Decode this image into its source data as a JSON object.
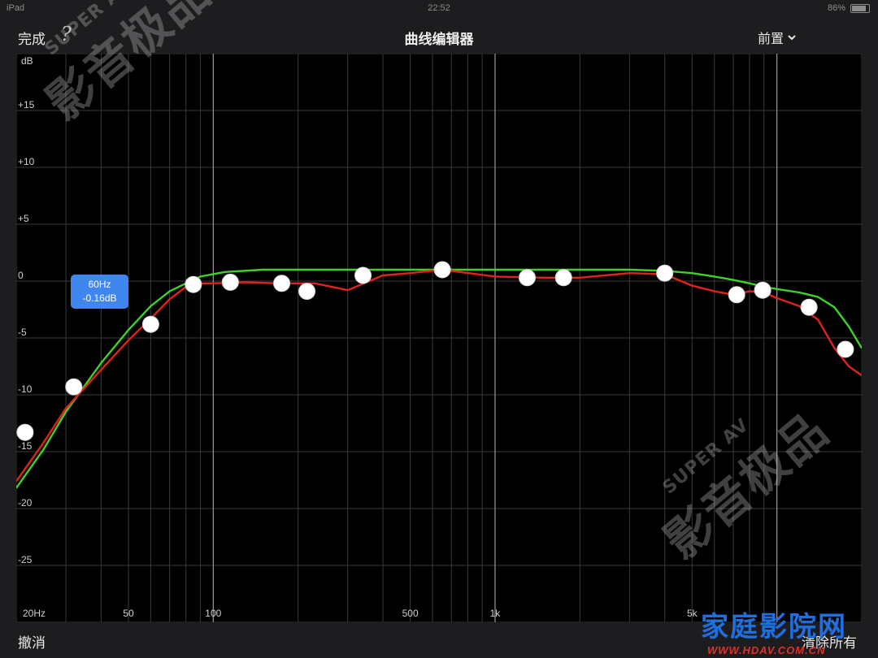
{
  "status_bar": {
    "device": "iPad",
    "time": "22:52",
    "battery": "86%",
    "battery_level": 0.86
  },
  "nav": {
    "done_label": "完成",
    "help_label": "?",
    "title": "曲线编辑器",
    "presets_label": "前置"
  },
  "toolbar": {
    "undo_label": "撤消",
    "clear_all_label": "清除所有"
  },
  "tooltip": {
    "freq": "60Hz",
    "gain": "-0.16dB"
  },
  "watermark": {
    "text": "影音极品",
    "sub": "SUPER AV"
  },
  "site_logo": {
    "name": "家庭影院网",
    "url": "WWW.HDAV.COM.CN"
  },
  "colors": {
    "target_curve": "#3fd129",
    "measured_curve": "#e0221c",
    "grid": "#3a3a3a",
    "grid_major": "#9a9a9a",
    "tooltip": "#3f86ee"
  },
  "chart_data": {
    "type": "line",
    "xscale": "log",
    "xlim": [
      20,
      20000
    ],
    "ylim": [
      -30,
      20
    ],
    "yunit_label": "dB",
    "ytick_labels": [
      {
        "value": 15,
        "label": "+15"
      },
      {
        "value": 10,
        "label": "+10"
      },
      {
        "value": 5,
        "label": "+5"
      },
      {
        "value": 0,
        "label": "0"
      },
      {
        "value": -5,
        "label": "-5"
      },
      {
        "value": -10,
        "label": "-10"
      },
      {
        "value": -15,
        "label": "-15"
      },
      {
        "value": -20,
        "label": "-20"
      },
      {
        "value": -25,
        "label": "-25"
      }
    ],
    "xtick_labels": [
      {
        "value": 20,
        "label": "20Hz"
      },
      {
        "value": 50,
        "label": "50"
      },
      {
        "value": 100,
        "label": "100"
      },
      {
        "value": 500,
        "label": "500"
      },
      {
        "value": 1000,
        "label": "1k"
      },
      {
        "value": 5000,
        "label": "5k"
      }
    ],
    "series": [
      {
        "id": "target",
        "x": [
          20,
          25,
          30,
          40,
          50,
          60,
          70,
          80,
          90,
          110,
          150,
          200,
          300,
          500,
          700,
          1000,
          1500,
          2000,
          3000,
          4000,
          5000,
          6000,
          7000,
          8000,
          9000,
          10000,
          12000,
          14000,
          16000,
          18000,
          20000
        ],
        "y": [
          -18.2,
          -14.8,
          -11.5,
          -7.2,
          -4.3,
          -2.2,
          -0.9,
          -0.2,
          0.4,
          0.8,
          1.0,
          1.0,
          1.0,
          1.0,
          1.0,
          1.0,
          1.0,
          1.0,
          1.0,
          0.9,
          0.7,
          0.4,
          0.1,
          -0.2,
          -0.5,
          -0.7,
          -1.0,
          -1.4,
          -2.3,
          -4.0,
          -5.9
        ]
      },
      {
        "id": "measured",
        "x": [
          20,
          25,
          30,
          40,
          50,
          60,
          70,
          80,
          90,
          100,
          130,
          170,
          230,
          300,
          400,
          500,
          650,
          1000,
          1500,
          2000,
          3000,
          4000,
          5000,
          6000,
          7000,
          8000,
          9000,
          10000,
          12000,
          14000,
          16000,
          18000,
          20000
        ],
        "y": [
          -17.6,
          -14.2,
          -11.2,
          -7.8,
          -5.2,
          -3.3,
          -1.6,
          -0.5,
          -0.2,
          -0.2,
          -0.1,
          -0.2,
          -0.2,
          -0.8,
          0.5,
          0.7,
          1.0,
          0.4,
          0.3,
          0.3,
          0.7,
          0.6,
          -0.4,
          -0.9,
          -1.2,
          -0.9,
          -1.0,
          -1.5,
          -2.2,
          -3.4,
          -5.9,
          -7.5,
          -8.3
        ]
      }
    ],
    "control_points": [
      {
        "x": 21.5,
        "y": -13.3
      },
      {
        "x": 32,
        "y": -9.3
      },
      {
        "x": 60,
        "y": -3.8
      },
      {
        "x": 85,
        "y": -0.3
      },
      {
        "x": 115,
        "y": -0.1
      },
      {
        "x": 175,
        "y": -0.2
      },
      {
        "x": 215,
        "y": -0.9
      },
      {
        "x": 340,
        "y": 0.5
      },
      {
        "x": 650,
        "y": 1.0
      },
      {
        "x": 1300,
        "y": 0.3
      },
      {
        "x": 1750,
        "y": 0.3
      },
      {
        "x": 4000,
        "y": 0.7
      },
      {
        "x": 7200,
        "y": -1.2
      },
      {
        "x": 8900,
        "y": -0.8
      },
      {
        "x": 13000,
        "y": -2.3
      },
      {
        "x": 17500,
        "y": -6.0
      }
    ]
  }
}
